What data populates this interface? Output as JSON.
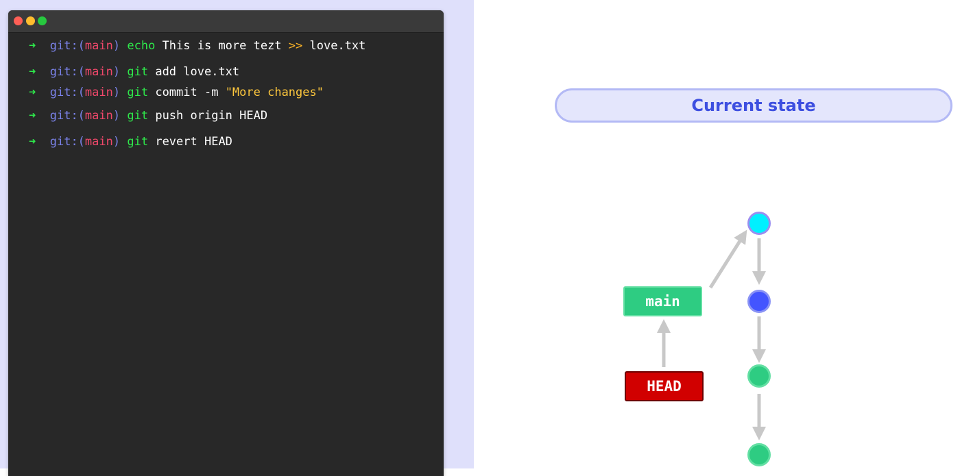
{
  "terminal": {
    "lines": [
      {
        "arrow": "➜",
        "git": "git:(",
        "branch": "main",
        "close": ")",
        "cmd": "echo",
        "text": " This is more tezt ",
        "redir": ">>",
        "tail": " love.txt"
      },
      {
        "arrow": "➜",
        "git": "git:(",
        "branch": "main",
        "close": ")",
        "cmd": "git",
        "text": " add love.txt"
      },
      {
        "arrow": "➜",
        "git": "git:(",
        "branch": "main",
        "close": ")",
        "cmd": "git",
        "text": " commit -m ",
        "str": "\"More changes\""
      },
      {
        "arrow": "➜",
        "git": "git:(",
        "branch": "main",
        "close": ")",
        "cmd": "git",
        "text": " push origin HEAD"
      },
      {
        "arrow": "➜",
        "git": "git:(",
        "branch": "main",
        "close": ")",
        "cmd": "git",
        "text": " revert HEAD"
      }
    ]
  },
  "panel": {
    "title": "Current state"
  },
  "graph": {
    "main_label": "main",
    "head_label": "HEAD",
    "commits": [
      {
        "name": "commit-newest",
        "color": "#00f0ff",
        "stroke": "#9a8ef0"
      },
      {
        "name": "commit-second",
        "color": "#4355ff",
        "stroke": "#8a93f5"
      },
      {
        "name": "commit-third",
        "color": "#2ecc82",
        "stroke": "#63dfa3"
      },
      {
        "name": "commit-oldest",
        "color": "#2ecc82",
        "stroke": "#63dfa3"
      }
    ],
    "arrow_color": "#c8c8c8"
  }
}
